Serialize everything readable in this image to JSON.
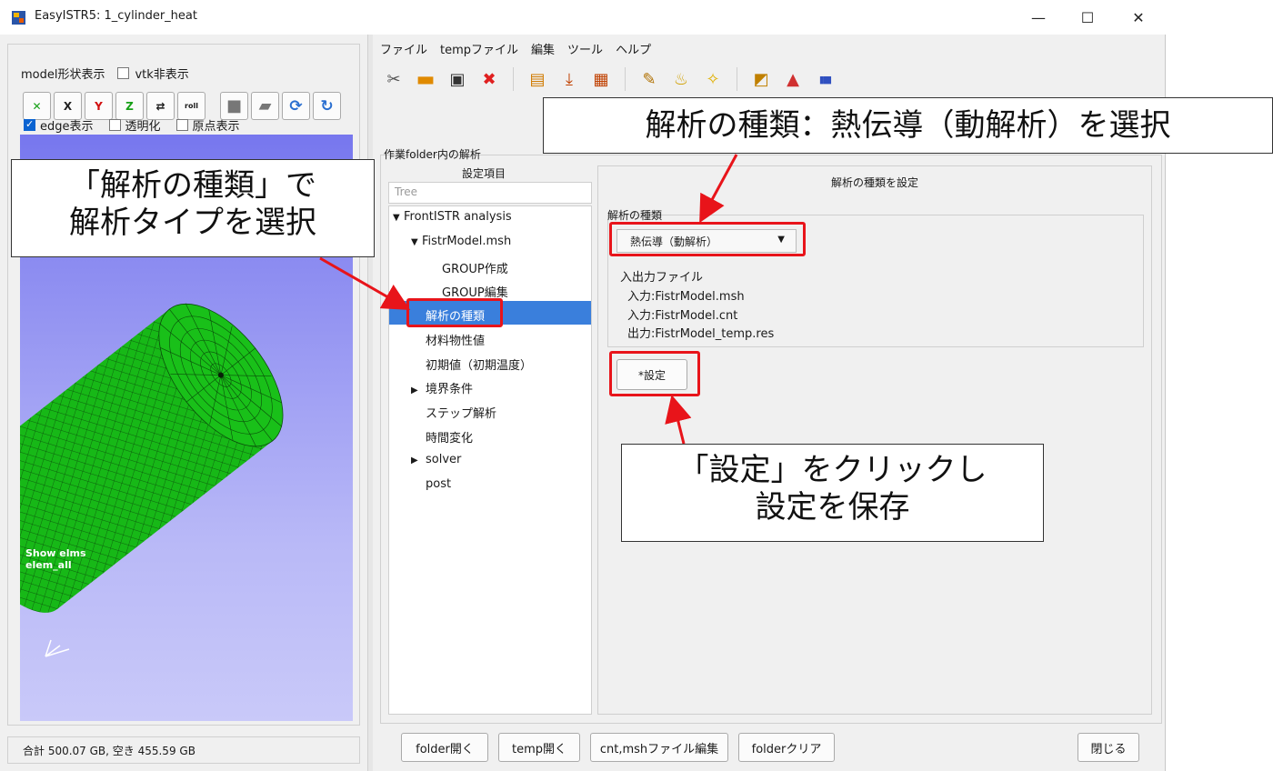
{
  "window": {
    "title": "EasyISTR5: 1_cylinder_heat",
    "min_glyph": "—",
    "max_glyph": "☐",
    "close_glyph": "✕"
  },
  "left": {
    "model_shape_label": "model形状表示",
    "vtk_hide_label": "vtk非表示",
    "edge_label": "edge表示",
    "transparent_label": "透明化",
    "origin_label": "原点表示",
    "toolbar": [
      {
        "name": "fit-view-icon",
        "glyph": "✕"
      },
      {
        "name": "x-axis-view-icon",
        "glyph": "X"
      },
      {
        "name": "y-axis-view-icon",
        "glyph": "Y"
      },
      {
        "name": "z-axis-view-icon",
        "glyph": "Z"
      },
      {
        "name": "swap-view-icon",
        "glyph": "⇄"
      },
      {
        "name": "roll-view-icon",
        "glyph": "roll"
      },
      {
        "name": "solid-cube-icon",
        "glyph": "■"
      },
      {
        "name": "wire-cube-icon",
        "glyph": "▰"
      },
      {
        "name": "reload-model-icon",
        "glyph": "⟳"
      },
      {
        "name": "refresh-icon",
        "glyph": "↻"
      }
    ],
    "viewport_text_line1": "Show elms",
    "viewport_text_line2": "elem_all",
    "status": "合計 500.07 GB, 空き 455.59 GB"
  },
  "menu": [
    "ファイル",
    "tempファイル",
    "編集",
    "ツール",
    "ヘルプ"
  ],
  "toolbar_right": [
    {
      "name": "tools-icon",
      "glyph": "✂"
    },
    {
      "name": "folder-open-icon",
      "glyph": "▬"
    },
    {
      "name": "terminal-icon",
      "glyph": "▣"
    },
    {
      "name": "close-red-icon",
      "glyph": "✖"
    },
    {
      "name": "file-open-icon",
      "glyph": "▤"
    },
    {
      "name": "dir-file-icon",
      "glyph": "⤓"
    },
    {
      "name": "tmp-file-icon",
      "glyph": "▦"
    },
    {
      "name": "edit-note-icon",
      "glyph": "✎"
    },
    {
      "name": "clear-brush-icon",
      "glyph": "♨"
    },
    {
      "name": "new-note-icon",
      "glyph": "✧"
    },
    {
      "name": "mesh-icon",
      "glyph": "◩"
    },
    {
      "name": "triangle-icon",
      "glyph": "▲"
    },
    {
      "name": "color-bars-icon",
      "glyph": "▮▮▮"
    }
  ],
  "analysis_group_title": "作業folder内の解析",
  "tree": {
    "header": "設定項目",
    "search_placeholder": "Tree",
    "items": [
      {
        "label": "FrontISTR analysis",
        "indent": 0,
        "arrow": "▼"
      },
      {
        "label": "FistrModel.msh",
        "indent": 1,
        "arrow": "▼"
      },
      {
        "label": "GROUP作成",
        "indent": 2,
        "arrow": ""
      },
      {
        "label": "GROUP編集",
        "indent": 2,
        "arrow": ""
      },
      {
        "label": "解析の種類",
        "indent": 1,
        "arrow": "",
        "selected": true
      },
      {
        "label": "材料物性値",
        "indent": 1,
        "arrow": ""
      },
      {
        "label": "初期値（初期温度）",
        "indent": 1,
        "arrow": ""
      },
      {
        "label": "境界条件",
        "indent": 1,
        "arrow": "▶"
      },
      {
        "label": "ステップ解析",
        "indent": 1,
        "arrow": ""
      },
      {
        "label": "時間変化",
        "indent": 1,
        "arrow": ""
      },
      {
        "label": "solver",
        "indent": 1,
        "arrow": "▶"
      },
      {
        "label": "post",
        "indent": 1,
        "arrow": ""
      }
    ]
  },
  "panel": {
    "title": "解析の種類を設定",
    "type_group_label": "解析の種類",
    "type_value": "熱伝導（動解析）",
    "io_title": "入出力ファイル",
    "io_input1": "入力:FistrModel.msh",
    "io_input2": "入力:FistrModel.cnt",
    "io_output": "出力:FistrModel_temp.res",
    "set_button": "*設定"
  },
  "bottom": {
    "folder_open": "folder開く",
    "temp_open": "temp開く",
    "cnt_msh_edit": "cnt,mshファイル編集",
    "folder_clear": "folderクリア",
    "close": "閉じる"
  },
  "annotations": {
    "type_select_line1": "「解析の種類」で",
    "type_select_line2": "解析タイプを選択",
    "heat_select": "解析の種類：熱伝導（動解析）を選択",
    "save_line1": "「設定」をクリックし",
    "save_line2": "設定を保存"
  },
  "colors": {
    "selection": "#3a7fdc",
    "annotation_red": "#e8141a",
    "mesh_green": "#17b817"
  }
}
